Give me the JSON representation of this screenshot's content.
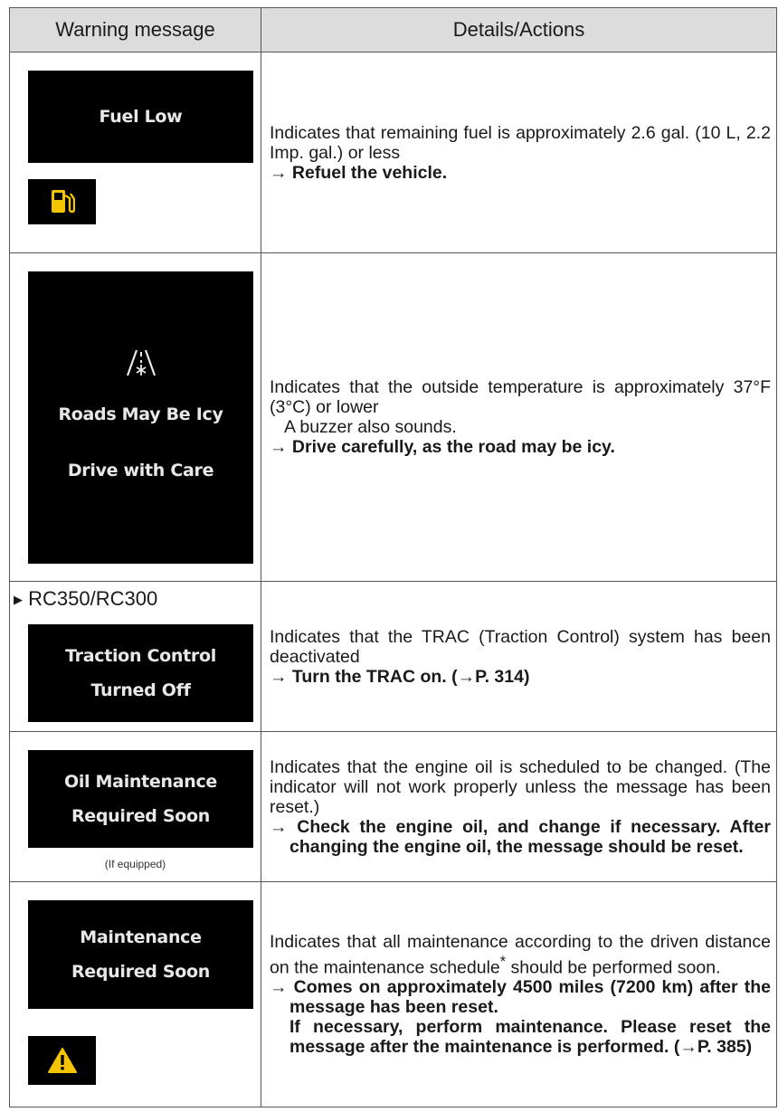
{
  "header": {
    "col1": "Warning message",
    "col2": "Details/Actions"
  },
  "rows": [
    {
      "screen_lines": [
        "Fuel Low"
      ],
      "indicator_icon": "fuel-pump-icon",
      "details": "Indicates that remaining fuel is approximately 2.6 gal. (10 L, 2.2 Imp. gal.) or less",
      "action": "→ Refuel the vehicle."
    },
    {
      "screen_icon": "icy-road-icon",
      "screen_lines": [
        "Roads May Be Icy",
        "Drive with Care"
      ],
      "details": "Indicates that the outside temperature is approximately 37°F (3°C) or lower",
      "note": "A buzzer also sounds.",
      "action": "→ Drive carefully, as the road may be icy."
    },
    {
      "model": "RC350/RC300",
      "screen_lines": [
        "Traction Control",
        "Turned Off"
      ],
      "details": "Indicates that the TRAC (Traction Control) system has been deactivated",
      "action": "→ Turn the TRAC on. (→P. 314)"
    },
    {
      "screen_lines": [
        "Oil Maintenance",
        "Required Soon"
      ],
      "footnote": "(If equipped)",
      "details": "Indicates that the engine oil is scheduled to be changed. (The indicator will not work properly unless the message has been reset.)",
      "action": "→ Check the engine oil, and change if necessary. After changing the engine oil, the message should be reset."
    },
    {
      "screen_lines": [
        "Maintenance",
        "Required Soon"
      ],
      "indicator_icon": "warning-triangle-icon",
      "details_pre": "Indicates that all maintenance according to the driven distance on the maintenance schedule",
      "details_mark": "*",
      "details_post": " should be performed soon.",
      "action": "→ Comes on approximately 4500 miles (7200 km) after the message has been reset.",
      "action2": "If necessary, perform maintenance. Please reset the message after the maintenance is performed. (→P. 385)"
    }
  ],
  "colors": {
    "header_bg": "#dcdcdc",
    "screen_bg": "#000000",
    "fuel_icon": "#f5c400",
    "warning_icon": "#f5c400"
  }
}
